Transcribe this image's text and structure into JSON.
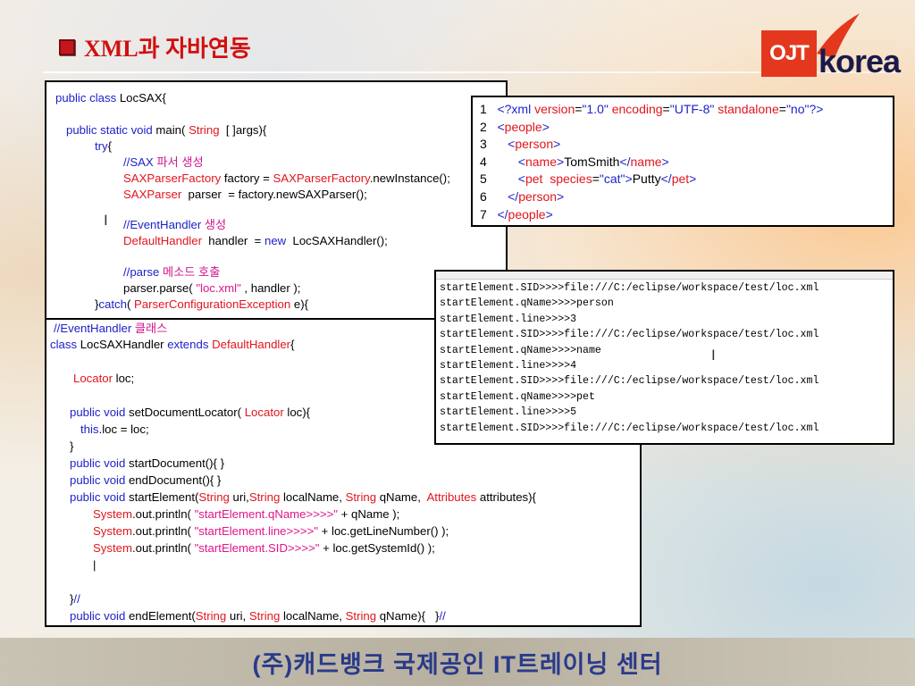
{
  "title": "XML과 자바연동",
  "logo": {
    "left": "OJT",
    "right": "korea"
  },
  "code1": [
    "public class LocSAX{",
    "public static void main( String [ ]args){",
    "try{",
    "//SAX 파서 생성",
    "SAXParserFactory factory = SAXParserFactory.newInstance();",
    "SAXParser  parser  = factory.newSAXParser();",
    "",
    "//EventHandler 생성",
    "DefaultHandler  handler  = new  LocSAXHandler();",
    "",
    "//parse 메소드 호출",
    "parser.parse( \"loc.xml\" , handler );",
    "}catch( ParserConfigurationException e){"
  ],
  "code2": [
    "//EventHandler 클래스",
    "class LocSAXHandler extends DefaultHandler{",
    "",
    "Locator loc;",
    "",
    "public void setDocumentLocator( Locator loc){",
    "this.loc = loc;",
    "}",
    "public void startDocument(){ }",
    "public void endDocument(){ }",
    "public void startElement(String uri,String localName, String qName,  Attributes attributes){",
    "System.out.println( \"startElement.qName>>>>\" + qName );",
    "System.out.println( \"startElement.line>>>>\" + loc.getLineNumber() );",
    "System.out.println( \"startElement.SID>>>>\" + loc.getSystemId() );",
    "|",
    "",
    "}//",
    "public void endElement(String uri, String localName, String qName){   }//"
  ],
  "xml": [
    "1   <?xml version=\"1.0\" encoding=\"UTF-8\" standalone=\"no\"?>",
    "2   <people>",
    "3      <person>",
    "4         <name>TomSmith</name>",
    "5         <pet  species=\"cat\">Putty</pet>",
    "6      </person>",
    "7   </people>"
  ],
  "console": [
    "startElement.SID>>>>file:///C:/eclipse/workspace/test/loc.xml",
    "startElement.qName>>>>person",
    "startElement.line>>>>3",
    "startElement.SID>>>>file:///C:/eclipse/workspace/test/loc.xml",
    "startElement.qName>>>>name",
    "startElement.line>>>>4",
    "startElement.SID>>>>file:///C:/eclipse/workspace/test/loc.xml",
    "startElement.qName>>>>pet",
    "startElement.line>>>>5",
    "startElement.SID>>>>file:///C:/eclipse/workspace/test/loc.xml"
  ],
  "footer": "(주)캐드뱅크 국제공인 IT트레이닝 센터",
  "icons": {
    "title_bullet": "square-bullet-icon",
    "text_cursor": "text-cursor-icon"
  },
  "colors": {
    "keyword": "#1e22c8",
    "type": "#e0161e",
    "string": "#e0168c",
    "title": "#d01010"
  }
}
